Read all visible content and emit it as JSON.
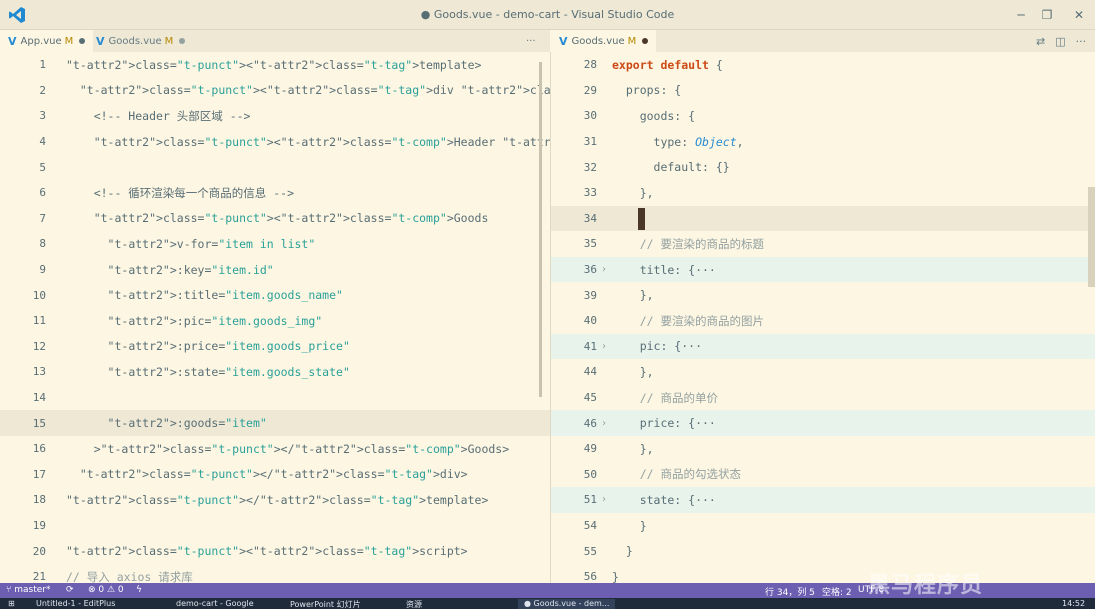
{
  "window": {
    "title": "● Goods.vue - demo-cart - Visual Studio Code"
  },
  "left_tabs": [
    {
      "name": "App.vue",
      "badge": "M"
    },
    {
      "name": "Goods.vue",
      "badge": "M"
    }
  ],
  "left_tab_more": "···",
  "right_tabs": [
    {
      "name": "Goods.vue",
      "badge": "M"
    }
  ],
  "right_tab_more": "···",
  "left_editor": {
    "lines": [
      {
        "n": "1",
        "code": "<template>"
      },
      {
        "n": "2",
        "code": "  <div class=\"app-container\">"
      },
      {
        "n": "3",
        "code": "    <!-- Header 头部区域 -->"
      },
      {
        "n": "4",
        "code": "    <Header title=\"购物车案例\"></Header>"
      },
      {
        "n": "5",
        "code": ""
      },
      {
        "n": "6",
        "code": "    <!-- 循环渲染每一个商品的信息 -->"
      },
      {
        "n": "7",
        "code": "    <Goods"
      },
      {
        "n": "8",
        "code": "      v-for=\"item in list\""
      },
      {
        "n": "9",
        "code": "      :key=\"item.id\""
      },
      {
        "n": "10",
        "code": "      :title=\"item.goods_name\""
      },
      {
        "n": "11",
        "code": "      :pic=\"item.goods_img\""
      },
      {
        "n": "12",
        "code": "      :price=\"item.goods_price\""
      },
      {
        "n": "13",
        "code": "      :state=\"item.goods_state\""
      },
      {
        "n": "14",
        "code": ""
      },
      {
        "n": "15",
        "code": "      :goods=\"item\""
      },
      {
        "n": "16",
        "code": "    ></Goods>"
      },
      {
        "n": "17",
        "code": "  </div>"
      },
      {
        "n": "18",
        "code": "</template>"
      },
      {
        "n": "19",
        "code": ""
      },
      {
        "n": "20",
        "code": "<script>"
      },
      {
        "n": "21",
        "code": "// 导入 axios 请求库"
      }
    ]
  },
  "right_editor": {
    "lines": [
      {
        "n": "28",
        "code": "export default {"
      },
      {
        "n": "29",
        "code": "  props: {"
      },
      {
        "n": "30",
        "code": "    goods: {"
      },
      {
        "n": "31",
        "code": "      type: Object,"
      },
      {
        "n": "32",
        "code": "      default: {}"
      },
      {
        "n": "33",
        "code": "    },"
      },
      {
        "n": "34",
        "code": ""
      },
      {
        "n": "35",
        "code": "    // 要渲染的商品的标题"
      },
      {
        "n": "36",
        "code": "    title: {···"
      },
      {
        "n": "39",
        "code": "    },"
      },
      {
        "n": "40",
        "code": "    // 要渲染的商品的图片"
      },
      {
        "n": "41",
        "code": "    pic: {···"
      },
      {
        "n": "44",
        "code": "    },"
      },
      {
        "n": "45",
        "code": "    // 商品的单价"
      },
      {
        "n": "46",
        "code": "    price: {···"
      },
      {
        "n": "49",
        "code": "    },"
      },
      {
        "n": "50",
        "code": "    // 商品的勾选状态"
      },
      {
        "n": "51",
        "code": "    state: {···"
      },
      {
        "n": "54",
        "code": "    }"
      },
      {
        "n": "55",
        "code": "  }"
      },
      {
        "n": "56",
        "code": "}"
      }
    ]
  },
  "status": {
    "branch": "master*",
    "sync": "",
    "problems": "⊗ 0 ⚠ 0",
    "position": "行 34，列 5",
    "spaces": "空格: 2",
    "encoding": "UTF-8"
  },
  "watermark": "黑马程序员",
  "taskbar": {
    "items": [
      "Untitled-1 - EditPlus",
      "demo-cart - Google",
      "PowerPoint 幻灯片",
      "资源",
      "● Goods.vue - dem..."
    ],
    "clock": "14:52"
  },
  "colors": {
    "background": "#fdf6e3",
    "statusbar": "#6c5eb1",
    "accent": "#268bd2"
  }
}
